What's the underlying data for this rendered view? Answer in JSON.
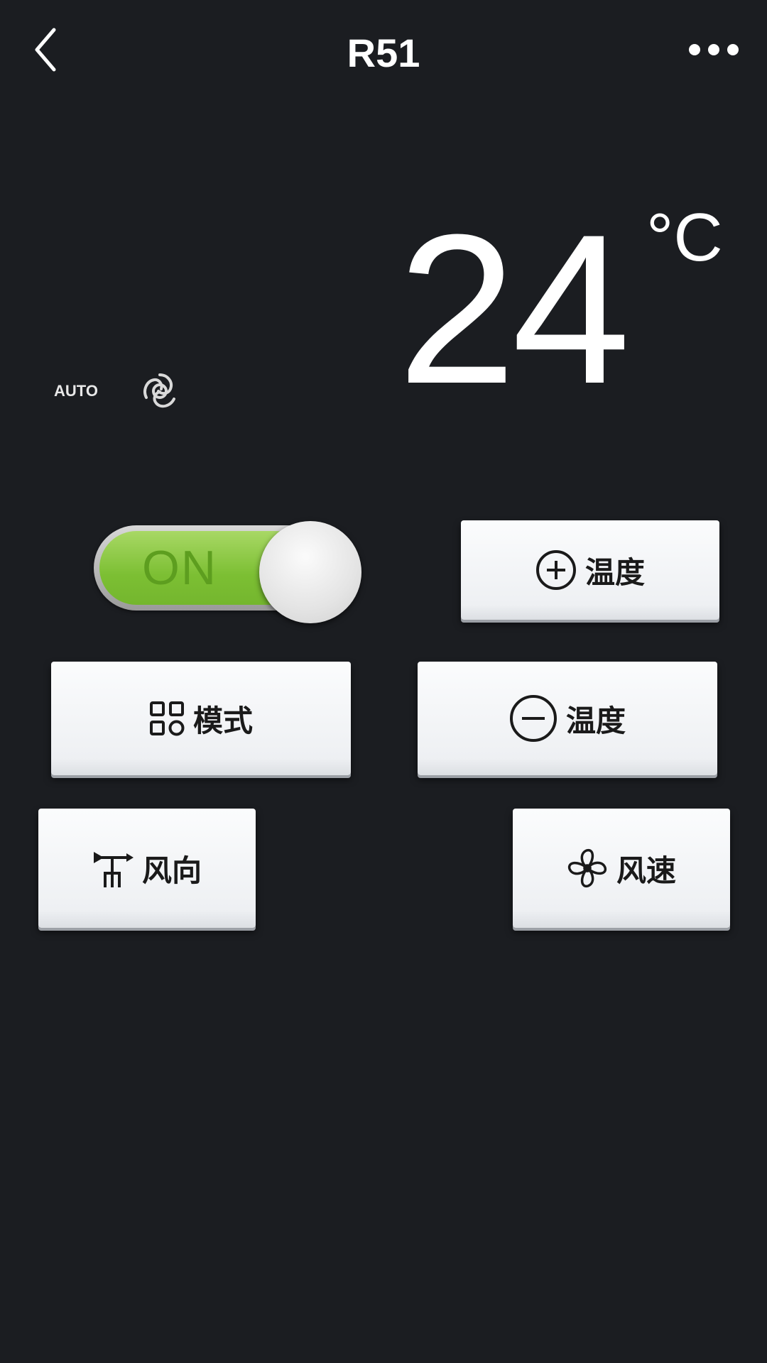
{
  "header": {
    "title": "R51",
    "back_icon": "chevron-left-icon",
    "more_icon": "more-horizontal-icon"
  },
  "temperature": {
    "value": "24",
    "unit": "°C"
  },
  "status": {
    "mode_label": "AUTO",
    "fan_icon": "swirl-icon"
  },
  "power": {
    "label": "ON",
    "state": "on",
    "color": "#8cc63f"
  },
  "controls": {
    "temp_up": {
      "label": "温度",
      "icon": "plus-circle-icon"
    },
    "mode": {
      "label": "模式",
      "icon": "grid-icon"
    },
    "temp_down": {
      "label": "温度",
      "icon": "minus-circle-icon"
    },
    "swing": {
      "label": "风向",
      "icon": "wind-vane-icon"
    },
    "fan_speed": {
      "label": "风速",
      "icon": "fan-icon"
    }
  },
  "colors": {
    "background": "#1b1d21",
    "button": "#f2f4f6",
    "text_light": "#ffffff"
  }
}
